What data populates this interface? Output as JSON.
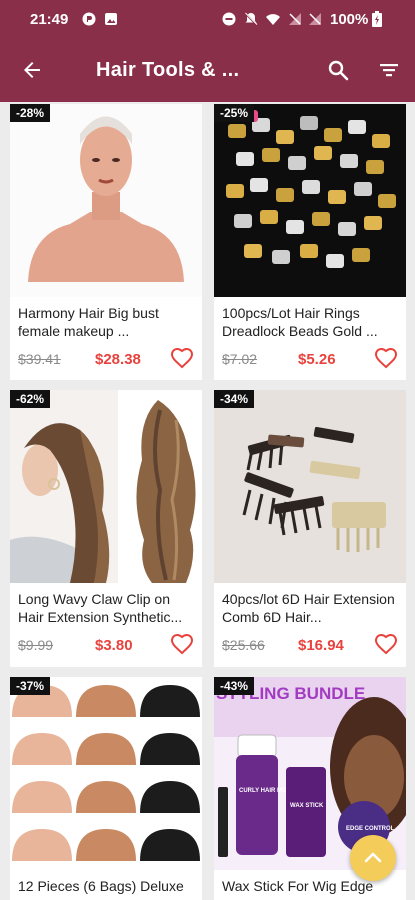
{
  "status_bar": {
    "time": "21:49",
    "battery": "100%"
  },
  "app_bar": {
    "title": "Hair Tools & ..."
  },
  "colors": {
    "brand": "#8a2f4a",
    "price": "#e8423d",
    "fab": "#f3cc5a"
  },
  "products": [
    {
      "discount": "-28%",
      "name": "Harmony Hair Big bust female makeup ...",
      "old_price": "$39.41",
      "new_price": "$28.38",
      "image": "mannequin-bust"
    },
    {
      "discount": "-25%",
      "name": "100pcs/Lot Hair Rings Dreadlock Beads Gold ...",
      "old_price": "$7.02",
      "new_price": "$5.26",
      "image": "hair-rings"
    },
    {
      "discount": "-62%",
      "name": "Long Wavy Claw Clip on Hair Extension Synthetic...",
      "old_price": "$9.99",
      "new_price": "$3.80",
      "image": "ponytail"
    },
    {
      "discount": "-34%",
      "name": "40pcs/lot 6D Hair Extension Comb 6D Hair...",
      "old_price": "$25.66",
      "new_price": "$16.94",
      "image": "combs"
    },
    {
      "discount": "-37%",
      "name": "12 Pieces (6 Bags) Deluxe",
      "old_price": "",
      "new_price": "",
      "image": "wig-caps"
    },
    {
      "discount": "-43%",
      "name": "Wax Stick For Wig Edge",
      "old_price": "",
      "new_price": "",
      "image": "bundle",
      "image_text": {
        "banner": "STYLING BUNDLE",
        "mousse": "CURLY HAIR MOUSSE",
        "wax": "WAX STICK",
        "edge": "EDGE CONTROL"
      }
    }
  ]
}
